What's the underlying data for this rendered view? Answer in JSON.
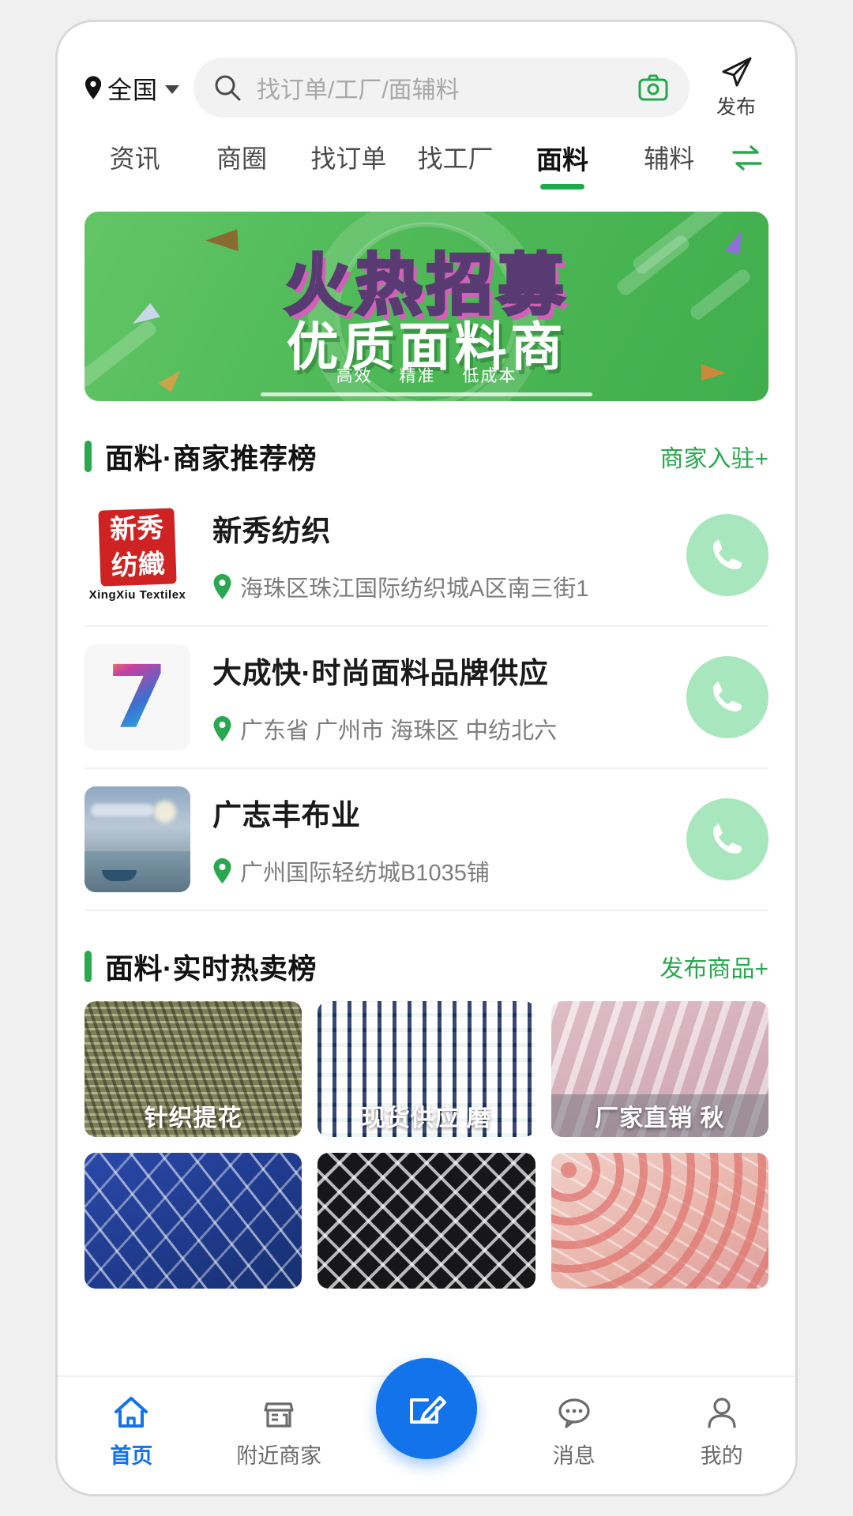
{
  "header": {
    "location": "全国",
    "location_icon": "map-pin-icon",
    "caret_icon": "chevron-down-icon",
    "search_placeholder": "找订单/工厂/面辅料",
    "search_icon": "search-icon",
    "camera_icon": "camera-icon",
    "publish_label": "发布",
    "publish_icon": "paper-plane-icon"
  },
  "tabs": {
    "items": [
      {
        "label": "资讯",
        "active": false
      },
      {
        "label": "商圈",
        "active": false
      },
      {
        "label": "找订单",
        "active": false
      },
      {
        "label": "找工厂",
        "active": false
      },
      {
        "label": "面料",
        "active": true
      },
      {
        "label": "辅料",
        "active": false
      }
    ],
    "swap_icon": "swap-arrows-icon"
  },
  "banner": {
    "title": "火热招募",
    "subtitle": "优质面料商",
    "tags": [
      "高效",
      "精准",
      "低成本"
    ],
    "bg_color": "#4fba57",
    "title_color": "#e77fd0"
  },
  "merchant_section": {
    "title": "面料·商家推荐榜",
    "action": "商家入驻+",
    "accent_color": "#2aa84f",
    "items": [
      {
        "name": "新秀纺织",
        "address": "海珠区珠江国际纺织城A区南三街1",
        "logo_type": "red-stamp",
        "logo_text": "新秀\n纺織",
        "logo_text_line1": "新秀",
        "logo_text_line2": "纺織",
        "logo_caption": "XingXiu  Textilex",
        "call_icon": "phone-icon",
        "pin_icon": "map-pin-icon"
      },
      {
        "name": "大成快·时尚面料品牌供应",
        "address": "广东省 广州市 海珠区 中纺北六",
        "logo_type": "paint-seven",
        "logo_text": "7",
        "call_icon": "phone-icon",
        "pin_icon": "map-pin-icon"
      },
      {
        "name": "广志丰布业",
        "address": "广州国际轻纺城B1035铺",
        "logo_type": "landscape-photo",
        "call_icon": "phone-icon",
        "pin_icon": "map-pin-icon"
      }
    ]
  },
  "product_section": {
    "title": "面料·实时热卖榜",
    "action": "发布商品+",
    "items": [
      {
        "label": "针织提花",
        "texture": "knit-olive",
        "shaded": false
      },
      {
        "label": "现货供应 磨",
        "texture": "plaid-green-blue",
        "shaded": false
      },
      {
        "label": "厂家直销 秋",
        "texture": "fleece-pink",
        "shaded": true
      },
      {
        "label": "",
        "texture": "leaf-blue",
        "shaded": false
      },
      {
        "label": "",
        "texture": "floral-black",
        "shaded": false
      },
      {
        "label": "",
        "texture": "lace-pink",
        "shaded": false
      }
    ]
  },
  "tabbar": {
    "items": [
      {
        "label": "首页",
        "icon": "home-icon",
        "active": true
      },
      {
        "label": "附近商家",
        "icon": "store-icon",
        "active": false
      },
      {
        "label": "",
        "icon": "compose-icon",
        "active": false
      },
      {
        "label": "消息",
        "icon": "chat-bubble-icon",
        "active": false
      },
      {
        "label": "我的",
        "icon": "person-icon",
        "active": false
      }
    ],
    "active_color": "#1273ea"
  }
}
